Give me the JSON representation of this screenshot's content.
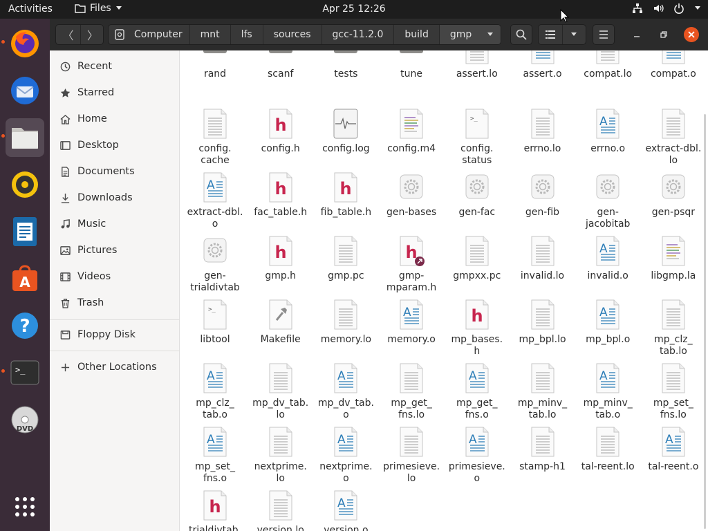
{
  "topbar": {
    "activities": "Activities",
    "app_menu": "Files",
    "clock": "Apr 25  12:26"
  },
  "path": [
    "Computer",
    "mnt",
    "lfs",
    "sources",
    "gcc-11.2.0",
    "build",
    "gmp"
  ],
  "sidebar": {
    "places": [
      {
        "label": "Recent",
        "icon": "clock-icon"
      },
      {
        "label": "Starred",
        "icon": "star-icon"
      },
      {
        "label": "Home",
        "icon": "home-icon"
      },
      {
        "label": "Desktop",
        "icon": "desktop-icon"
      },
      {
        "label": "Documents",
        "icon": "document-icon"
      },
      {
        "label": "Downloads",
        "icon": "download-icon"
      },
      {
        "label": "Music",
        "icon": "music-icon"
      },
      {
        "label": "Pictures",
        "icon": "picture-icon"
      },
      {
        "label": "Videos",
        "icon": "video-icon"
      },
      {
        "label": "Trash",
        "icon": "trash-icon"
      }
    ],
    "devices": [
      {
        "label": "Floppy Disk",
        "icon": "floppy-icon"
      }
    ],
    "other": {
      "label": "Other Locations",
      "icon": "plus-icon"
    }
  },
  "files": {
    "partial_row": [
      {
        "name": "rand",
        "type": "folder"
      },
      {
        "name": "scanf",
        "type": "folder"
      },
      {
        "name": "tests",
        "type": "folder"
      },
      {
        "name": "tune",
        "type": "folder"
      },
      {
        "name": "assert.lo",
        "type": "text"
      },
      {
        "name": "assert.o",
        "type": "object"
      },
      {
        "name": "compat.lo",
        "type": "text"
      },
      {
        "name": "compat.o",
        "type": "object"
      }
    ],
    "items": [
      {
        "name": "config.\ncache",
        "type": "text"
      },
      {
        "name": "config.h",
        "type": "header"
      },
      {
        "name": "config.log",
        "type": "log"
      },
      {
        "name": "config.m4",
        "type": "source"
      },
      {
        "name": "config.\nstatus",
        "type": "script"
      },
      {
        "name": "errno.lo",
        "type": "text"
      },
      {
        "name": "errno.o",
        "type": "object"
      },
      {
        "name": "extract-dbl.\nlo",
        "type": "text"
      },
      {
        "name": "extract-dbl.\no",
        "type": "object"
      },
      {
        "name": "fac_table.h",
        "type": "header"
      },
      {
        "name": "fib_table.h",
        "type": "header"
      },
      {
        "name": "gen-bases",
        "type": "exec"
      },
      {
        "name": "gen-fac",
        "type": "exec"
      },
      {
        "name": "gen-fib",
        "type": "exec"
      },
      {
        "name": "gen-\njacobitab",
        "type": "exec"
      },
      {
        "name": "gen-psqr",
        "type": "exec"
      },
      {
        "name": "gen-\ntrialdivtab",
        "type": "exec"
      },
      {
        "name": "gmp.h",
        "type": "header"
      },
      {
        "name": "gmp.pc",
        "type": "text"
      },
      {
        "name": "gmp-\nmparam.h",
        "type": "header-link"
      },
      {
        "name": "gmpxx.pc",
        "type": "text"
      },
      {
        "name": "invalid.lo",
        "type": "text"
      },
      {
        "name": "invalid.o",
        "type": "object"
      },
      {
        "name": "libgmp.la",
        "type": "source"
      },
      {
        "name": "libtool",
        "type": "script"
      },
      {
        "name": "Makefile",
        "type": "makefile"
      },
      {
        "name": "memory.lo",
        "type": "text"
      },
      {
        "name": "memory.o",
        "type": "object"
      },
      {
        "name": "mp_bases.\nh",
        "type": "header"
      },
      {
        "name": "mp_bpl.lo",
        "type": "text"
      },
      {
        "name": "mp_bpl.o",
        "type": "object"
      },
      {
        "name": "mp_clz_\ntab.lo",
        "type": "text"
      },
      {
        "name": "mp_clz_\ntab.o",
        "type": "object"
      },
      {
        "name": "mp_dv_tab.\nlo",
        "type": "text"
      },
      {
        "name": "mp_dv_tab.\no",
        "type": "object"
      },
      {
        "name": "mp_get_\nfns.lo",
        "type": "text"
      },
      {
        "name": "mp_get_\nfns.o",
        "type": "object"
      },
      {
        "name": "mp_minv_\ntab.lo",
        "type": "text"
      },
      {
        "name": "mp_minv_\ntab.o",
        "type": "object"
      },
      {
        "name": "mp_set_\nfns.lo",
        "type": "text"
      },
      {
        "name": "mp_set_\nfns.o",
        "type": "object"
      },
      {
        "name": "nextprime.\nlo",
        "type": "text"
      },
      {
        "name": "nextprime.\no",
        "type": "object"
      },
      {
        "name": "primesieve.\nlo",
        "type": "text"
      },
      {
        "name": "primesieve.\no",
        "type": "object"
      },
      {
        "name": "stamp-h1",
        "type": "text"
      },
      {
        "name": "tal-reent.lo",
        "type": "text"
      },
      {
        "name": "tal-reent.o",
        "type": "object"
      },
      {
        "name": "trialdivtab.\nh",
        "type": "header"
      },
      {
        "name": "version.lo",
        "type": "text"
      },
      {
        "name": "version.o",
        "type": "object"
      }
    ]
  },
  "colors": {
    "header_accent": "#c7254e",
    "object_accent": "#2f7fb8",
    "close_button": "#e95420",
    "topbar": "#1d1d1d",
    "headerbar": "#2b2b2b"
  }
}
